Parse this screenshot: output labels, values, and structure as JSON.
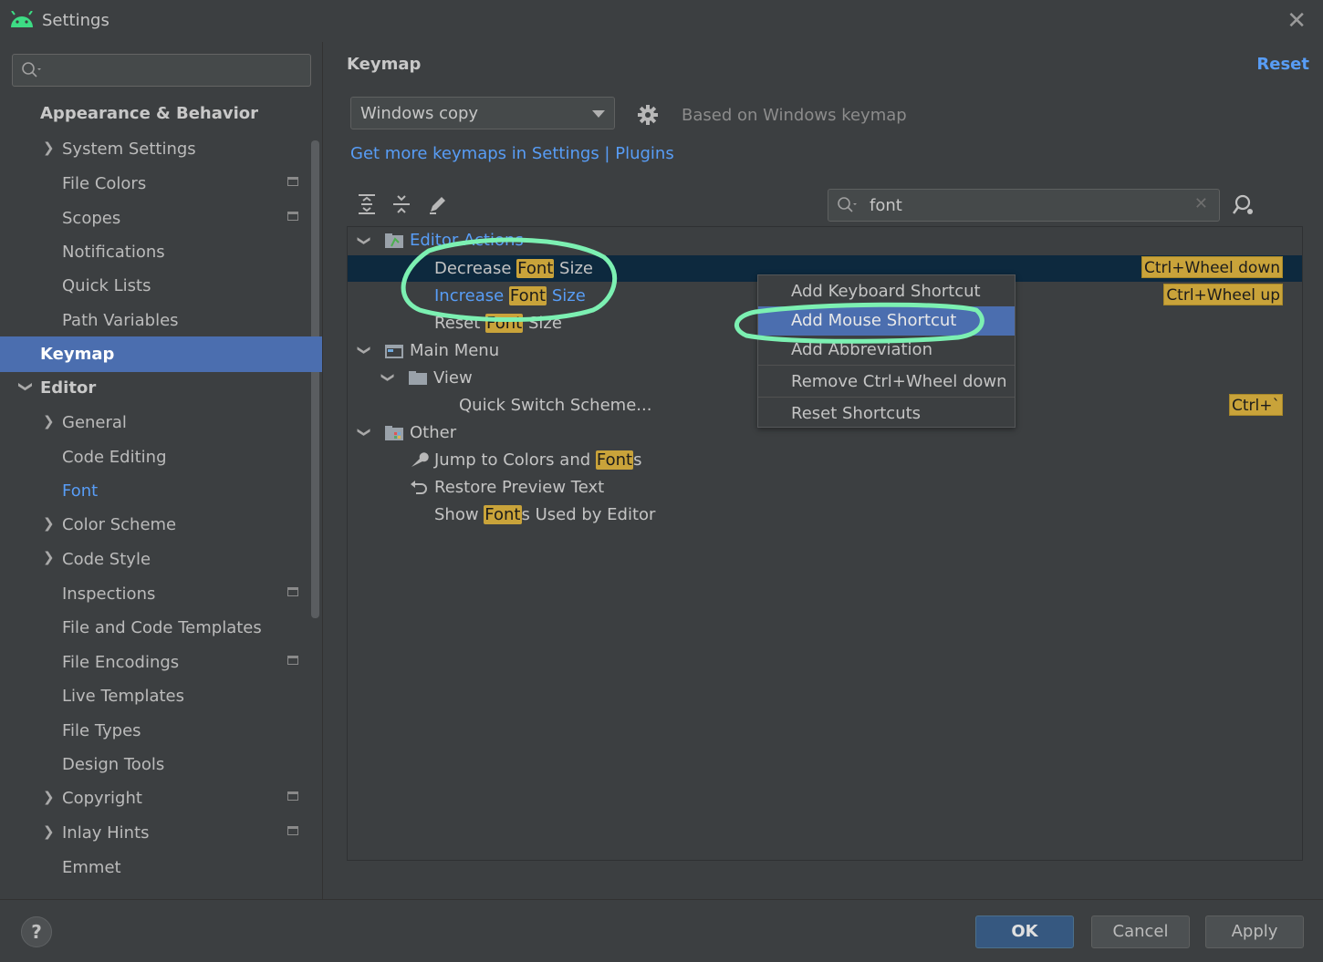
{
  "window": {
    "title": "Settings"
  },
  "sidebar": {
    "search_placeholder": "",
    "items": [
      {
        "label": "Appearance & Behavior"
      },
      {
        "label": "System Settings"
      },
      {
        "label": "File Colors"
      },
      {
        "label": "Scopes"
      },
      {
        "label": "Notifications"
      },
      {
        "label": "Quick Lists"
      },
      {
        "label": "Path Variables"
      },
      {
        "label": "Keymap"
      },
      {
        "label": "Editor"
      },
      {
        "label": "General"
      },
      {
        "label": "Code Editing"
      },
      {
        "label": "Font"
      },
      {
        "label": "Color Scheme"
      },
      {
        "label": "Code Style"
      },
      {
        "label": "Inspections"
      },
      {
        "label": "File and Code Templates"
      },
      {
        "label": "File Encodings"
      },
      {
        "label": "Live Templates"
      },
      {
        "label": "File Types"
      },
      {
        "label": "Design Tools"
      },
      {
        "label": "Copyright"
      },
      {
        "label": "Inlay Hints"
      },
      {
        "label": "Emmet"
      }
    ]
  },
  "main": {
    "title": "Keymap",
    "reset_label": "Reset",
    "keymap_select": "Windows copy",
    "based_on": "Based on Windows keymap",
    "more_keymaps_link": "Get more keymaps in Settings | Plugins",
    "search_value": "font"
  },
  "tree": {
    "editor_actions": "Editor Actions",
    "decrease": {
      "pre": "Decrease ",
      "hl": "Font",
      "post": " Size",
      "shortcut": "Ctrl+Wheel down"
    },
    "increase": {
      "pre": "Increase ",
      "hl": "Font",
      "post": " Size",
      "shortcut": "Ctrl+Wheel up"
    },
    "reset": {
      "pre": "Reset ",
      "hl": "Font",
      "post": " Size"
    },
    "main_menu": "Main Menu",
    "view": "View",
    "quick_switch": {
      "label": "Quick Switch Scheme...",
      "shortcut": "Ctrl+`"
    },
    "other": "Other",
    "jump": {
      "pre": "Jump to Colors and ",
      "hl": "Font",
      "post": "s"
    },
    "restore": "Restore Preview Text",
    "show": {
      "pre": "Show ",
      "hl": "Font",
      "post": "s Used by Editor"
    }
  },
  "context_menu": {
    "items": [
      "Add Keyboard Shortcut",
      "Add Mouse Shortcut",
      "Add Abbreviation",
      "Remove Ctrl+Wheel down",
      "Reset Shortcuts"
    ]
  },
  "buttons": {
    "help": "?",
    "ok": "OK",
    "cancel": "Cancel",
    "apply": "Apply"
  },
  "colors": {
    "accent": "#4b6eaf",
    "link": "#589df6",
    "highlight": "#c9a33a",
    "annotation": "#7cf0b2"
  }
}
